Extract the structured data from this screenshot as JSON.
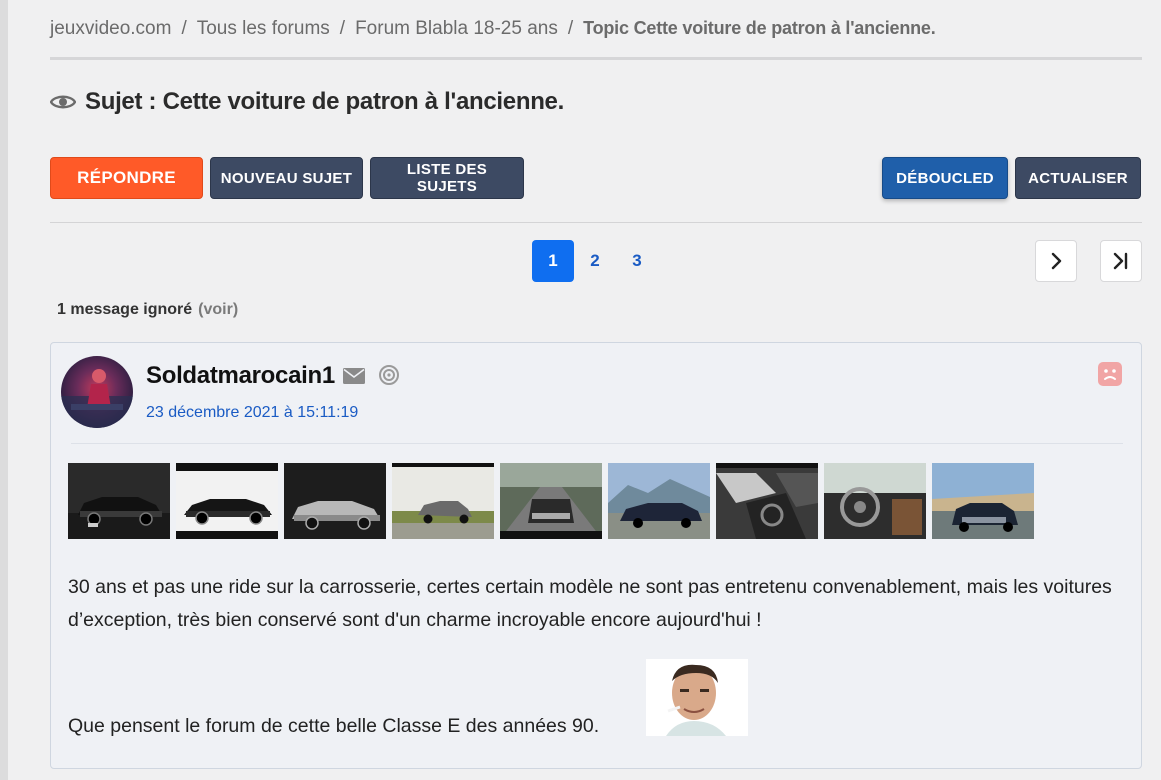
{
  "breadcrumb": {
    "items": [
      "jeuxvideo.com",
      "Tous les forums",
      "Forum Blabla 18-25 ans"
    ],
    "separator": "/",
    "current": "Topic Cette voiture de patron à l'ancienne."
  },
  "topic": {
    "icon": "eye-icon",
    "title": "Sujet : Cette voiture de patron à l'ancienne."
  },
  "toolbar": {
    "reply_label": "RÉPONDRE",
    "new_topic_label": "NOUVEAU SUJET",
    "topic_list_label": "LISTE DES SUJETS",
    "debouc_label": "DÉBOUCLED",
    "refresh_label": "ACTUALISER"
  },
  "pagination": {
    "pages": [
      "1",
      "2",
      "3"
    ],
    "current": "1",
    "next_icon": "chevron-right-icon",
    "last_icon": "last-page-icon"
  },
  "ignored": {
    "text": "1 message ignoré",
    "link": "(voir)"
  },
  "post": {
    "author": "Soldatmarocain1",
    "date": "23 décembre 2021 à 15:11:19",
    "icons": [
      "mail-icon",
      "spiral-icon",
      "report-icon"
    ],
    "thumbnail_count": 9,
    "body_1": "30 ans et pas une ride sur la carrosserie, certes certain modèle ne sont pas entretenu convenablement, mais les voitures d’exception, très bien conservé sont d'un charme incroyable encore aujourd'hui !",
    "body_2": "Que pensent le forum de cette belle Classe E des années 90."
  },
  "colors": {
    "reply": "#ff5a28",
    "dark_button": "#3d4a63",
    "blue_button": "#1f5faa",
    "active_page": "#0f6ef0",
    "link": "#1a5bc4"
  }
}
